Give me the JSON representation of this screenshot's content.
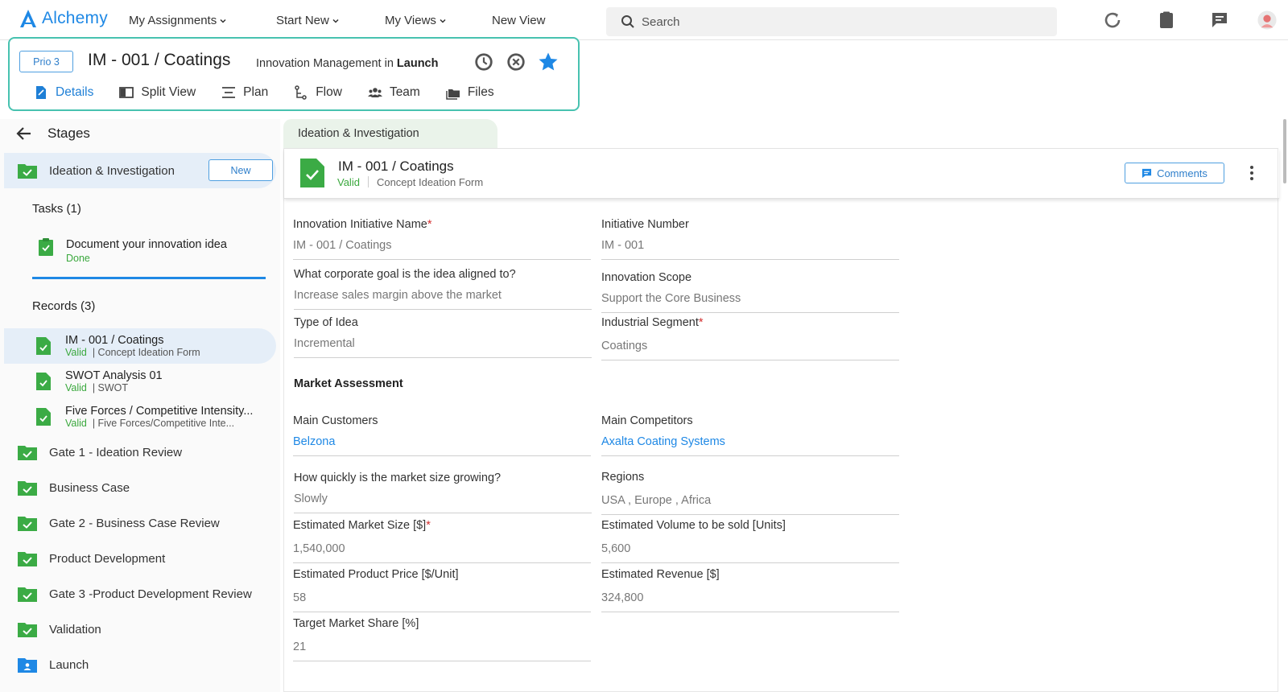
{
  "nav": {
    "brand": "Alchemy",
    "links": [
      "My Assignments",
      "Start New",
      "My Views",
      "New View"
    ],
    "search_placeholder": "Search",
    "icons": [
      "history-icon",
      "clipboard-icon",
      "chat-icon",
      "user-avatar"
    ]
  },
  "header": {
    "priority": "Prio 3",
    "title": "IM - 001 / Coatings",
    "subtitle_pre": "Innovation Management in ",
    "subtitle_stage": "Launch",
    "tabs": [
      "Details",
      "Split View",
      "Plan",
      "Flow",
      "Team",
      "Files"
    ],
    "active_tab": "Details"
  },
  "sidebar": {
    "title": "Stages",
    "current_stage": {
      "label": "Ideation & Investigation",
      "button": "New"
    },
    "tasks_title": "Tasks (1)",
    "task": {
      "label": "Document your innovation idea",
      "status": "Done"
    },
    "records_title": "Records (3)",
    "records": [
      {
        "title": "IM - 001 / Coatings",
        "status": "Valid",
        "type": "| Concept Ideation Form"
      },
      {
        "title": "SWOT Analysis 01",
        "status": "Valid",
        "type": "| SWOT"
      },
      {
        "title": "Five Forces / Competitive Intensity...",
        "status": "Valid",
        "type": "| Five Forces/Competitive Inte..."
      }
    ],
    "stages": [
      "Gate 1 - Ideation Review",
      "Business Case",
      "Gate 2 - Business Case Review",
      "Product Development",
      "Gate 3 -Product Development Review",
      "Validation",
      "Launch"
    ]
  },
  "main": {
    "stage_tab": "Ideation & Investigation",
    "card": {
      "title": "IM - 001 / Coatings",
      "status": "Valid",
      "type": "Concept Ideation Form",
      "comments_label": "Comments"
    },
    "fields": {
      "initiative_name": {
        "label": "Innovation Initiative Name",
        "value": "IM - 001 / Coatings"
      },
      "initiative_number": {
        "label": "Initiative Number",
        "value": "IM - 001"
      },
      "corporate_goal": {
        "label": "What corporate goal is the idea aligned to?",
        "value": "Increase sales margin above the market"
      },
      "innovation_scope": {
        "label": "Innovation Scope",
        "value": "Support the Core Business"
      },
      "type_of_idea": {
        "label": "Type of Idea",
        "value": "Incremental"
      },
      "industrial_segment": {
        "label": "Industrial Segment",
        "value": "Coatings"
      },
      "market_section": "Market Assessment",
      "main_customers": {
        "label": "Main Customers",
        "value": "Belzona"
      },
      "main_competitors": {
        "label": "Main Competitors",
        "value": "Axalta Coating Systems"
      },
      "market_growth": {
        "label": "How quickly is the market size growing?",
        "value": "Slowly"
      },
      "regions": {
        "label": "Regions",
        "value": "USA , Europe , Africa"
      },
      "market_size": {
        "label": "Estimated Market Size [$]",
        "value": "1,540,000"
      },
      "volume": {
        "label": "Estimated Volume to be sold [Units]",
        "value": "5,600"
      },
      "price": {
        "label": "Estimated Product Price [$/Unit]",
        "value": "58"
      },
      "revenue": {
        "label": "Estimated Revenue [$]",
        "value": "324,800"
      },
      "market_share": {
        "label": "Target Market Share [%]",
        "value": "21"
      }
    }
  },
  "colors": {
    "brand_blue": "#1e88e5",
    "accent_teal": "#47c2b0",
    "status_green": "#3aa83d",
    "folder_green": "#3bab45",
    "required_red": "#d32f2f"
  }
}
